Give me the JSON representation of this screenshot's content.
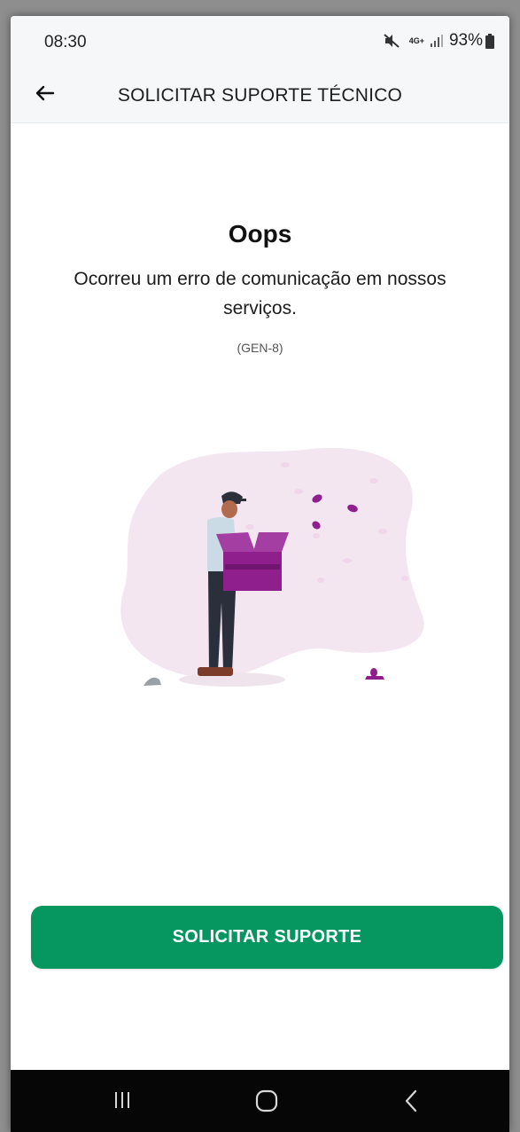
{
  "status_bar": {
    "time": "08:30",
    "network": "4G+",
    "battery": "93%",
    "icons": [
      "mute-icon",
      "network-4g-icon",
      "signal-icon",
      "battery-icon"
    ]
  },
  "app_bar": {
    "title": "SOLICITAR SUPORTE TÉCNICO",
    "back_icon": "arrow-left-icon"
  },
  "error": {
    "title": "Oops",
    "message": "Ocorreu um erro de comunicação em nossos serviços.",
    "code": "(GEN-8)"
  },
  "illustration": "man-holding-empty-box",
  "actions": {
    "support_label": "SOLICITAR SUPORTE"
  },
  "nav_bar": {
    "items": [
      "recent-apps-icon",
      "home-icon",
      "back-icon"
    ]
  },
  "colors": {
    "primary": "#069760",
    "accent": "#8e1f8c",
    "blob": "#f3e6f1",
    "app_bar_bg": "#f6f7f9",
    "nav_bg": "#060606"
  }
}
